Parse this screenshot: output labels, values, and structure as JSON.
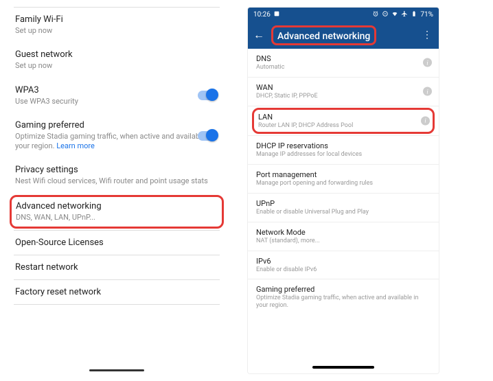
{
  "left": {
    "items": [
      {
        "title": "Family Wi-Fi",
        "sub": "Set up now"
      },
      {
        "title": "Guest network",
        "sub": "Set up now"
      },
      {
        "title": "WPA3",
        "sub": "Use WPA3 security"
      },
      {
        "title": "Gaming preferred",
        "sub": "Optimize Stadia gaming traffic, when active and available in your region. ",
        "link": "Learn more"
      },
      {
        "title": "Privacy settings",
        "sub": "Nest Wifi cloud services, Wifi router and point usage stats"
      },
      {
        "title": "Advanced networking",
        "sub": "DNS, WAN, LAN, UPnP..."
      },
      {
        "title": "Open-Source Licenses"
      },
      {
        "title": "Restart network"
      },
      {
        "title": "Factory reset network"
      }
    ]
  },
  "right": {
    "status": {
      "time": "10:26",
      "battery": "71%"
    },
    "appbar": {
      "title": "Advanced networking"
    },
    "items": [
      {
        "title": "DNS",
        "sub": "Automatic",
        "info": true
      },
      {
        "title": "WAN",
        "sub": "DHCP, Static IP, PPPoE",
        "info": true
      },
      {
        "title": "LAN",
        "sub": "Router LAN IP, DHCP Address Pool",
        "info": true,
        "highlight": true
      },
      {
        "title": "DHCP IP reservations",
        "sub": "Manage IP addresses for local devices"
      },
      {
        "title": "Port management",
        "sub": "Manage port opening and forwarding rules"
      },
      {
        "title": "UPnP",
        "sub": "Enable or disable Universal Plug and Play"
      },
      {
        "title": "Network Mode",
        "sub": "NAT (standard), more..."
      },
      {
        "title": "IPv6",
        "sub": "Enable or disable IPv6"
      },
      {
        "title": "Gaming preferred",
        "sub": "Optimize Stadia gaming traffic, when active and available in your region."
      }
    ]
  }
}
